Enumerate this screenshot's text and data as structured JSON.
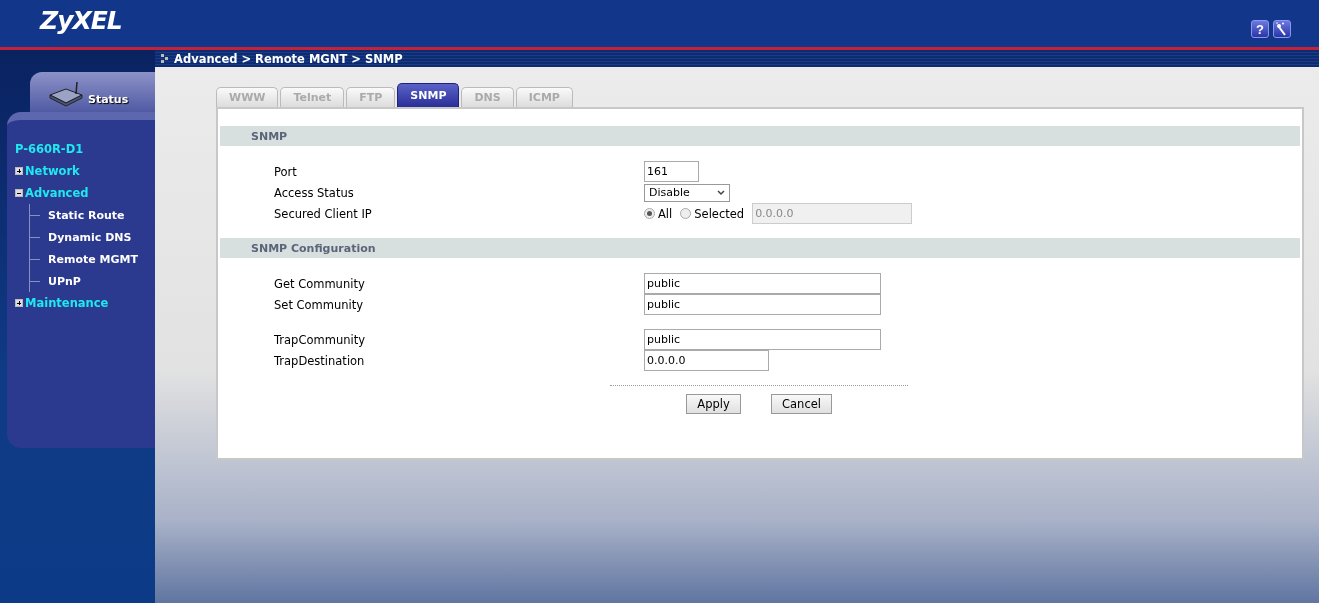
{
  "header": {
    "logo": "ZyXEL",
    "help_button": "?"
  },
  "breadcrumb": "Advanced > Remote MGNT > SNMP",
  "sidebar": {
    "status_tab": "Status",
    "device": "P-660R-D1",
    "tree": [
      {
        "label": "Network",
        "expanded": false
      },
      {
        "label": "Advanced",
        "expanded": true,
        "children": [
          {
            "label": "Static Route"
          },
          {
            "label": "Dynamic DNS"
          },
          {
            "label": "Remote MGMT"
          },
          {
            "label": "UPnP"
          }
        ]
      },
      {
        "label": "Maintenance",
        "expanded": false
      }
    ]
  },
  "tabs": [
    {
      "label": "WWW",
      "selected": false
    },
    {
      "label": "Telnet",
      "selected": false
    },
    {
      "label": "FTP",
      "selected": false
    },
    {
      "label": "SNMP",
      "selected": true
    },
    {
      "label": "DNS",
      "selected": false
    },
    {
      "label": "ICMP",
      "selected": false
    }
  ],
  "sections": [
    {
      "title": "SNMP",
      "groups": [
        [
          {
            "kind": "short-text",
            "label": "Port",
            "value": "161"
          },
          {
            "kind": "select",
            "label": "Access Status",
            "value": "Disable"
          },
          {
            "kind": "radio",
            "label": "Secured Client IP",
            "options": [
              {
                "label": "All",
                "selected": true
              },
              {
                "label": "Selected",
                "selected": false
              }
            ],
            "ip": "0.0.0.0",
            "ip_disabled": true
          }
        ]
      ]
    },
    {
      "title": "SNMP Configuration",
      "groups": [
        [
          {
            "kind": "long-text",
            "label": "Get Community",
            "value": "public"
          },
          {
            "kind": "long-text",
            "label": "Set Community",
            "value": "public"
          }
        ],
        [
          {
            "kind": "long-text",
            "label": "TrapCommunity",
            "value": "public"
          },
          {
            "kind": "medium-text",
            "label": "TrapDestination",
            "value": "0.0.0.0"
          }
        ]
      ]
    }
  ],
  "buttons": [
    "Apply",
    "Cancel"
  ]
}
